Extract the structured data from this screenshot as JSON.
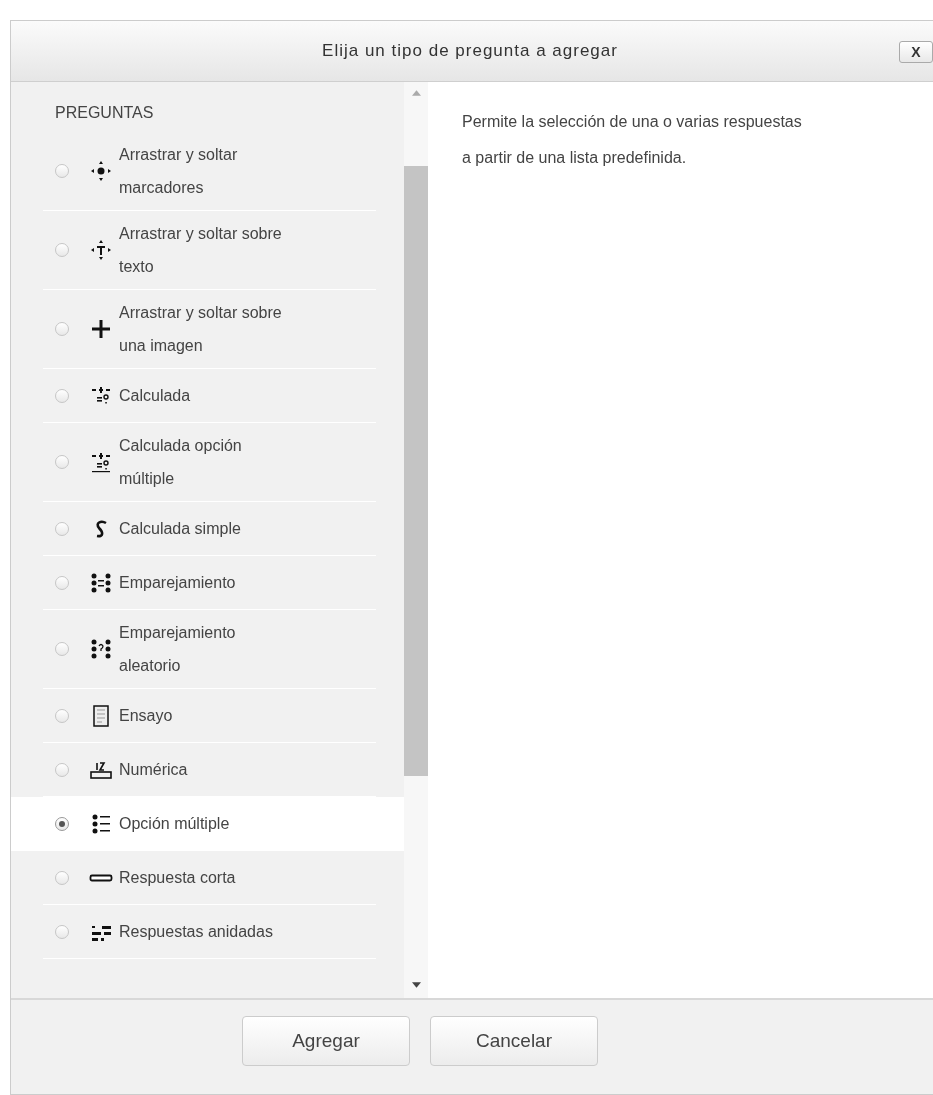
{
  "dialog": {
    "title": "Elija un tipo de pregunta a agregar",
    "close": "X"
  },
  "list": {
    "heading": "PREGUNTAS",
    "items": [
      {
        "label": "Arrastrar y soltar marcadores",
        "kind": "drag-markers",
        "selected": false
      },
      {
        "label": "Arrastrar y soltar sobre texto",
        "kind": "drag-text",
        "selected": false
      },
      {
        "label": "Arrastrar y soltar sobre una imagen",
        "kind": "drag-image",
        "selected": false
      },
      {
        "label": "Calculada",
        "kind": "calculated",
        "selected": false
      },
      {
        "label": "Calculada opción múltiple",
        "kind": "calculated-multi",
        "selected": false
      },
      {
        "label": "Calculada simple",
        "kind": "calculated-simple",
        "selected": false
      },
      {
        "label": "Emparejamiento",
        "kind": "matching",
        "selected": false
      },
      {
        "label": "Emparejamiento aleatorio",
        "kind": "random-matching",
        "selected": false
      },
      {
        "label": "Ensayo",
        "kind": "essay",
        "selected": false
      },
      {
        "label": "Numérica",
        "kind": "numerical",
        "selected": false
      },
      {
        "label": "Opción múltiple",
        "kind": "multichoice",
        "selected": true
      },
      {
        "label": "Respuesta corta",
        "kind": "short-answer",
        "selected": false
      },
      {
        "label": "Respuestas anidadas",
        "kind": "cloze",
        "selected": false
      }
    ]
  },
  "description": "Permite la selección de una o varias respuestas a partir de una lista predefinida.",
  "buttons": [
    "Agregar",
    "Cancelar"
  ]
}
